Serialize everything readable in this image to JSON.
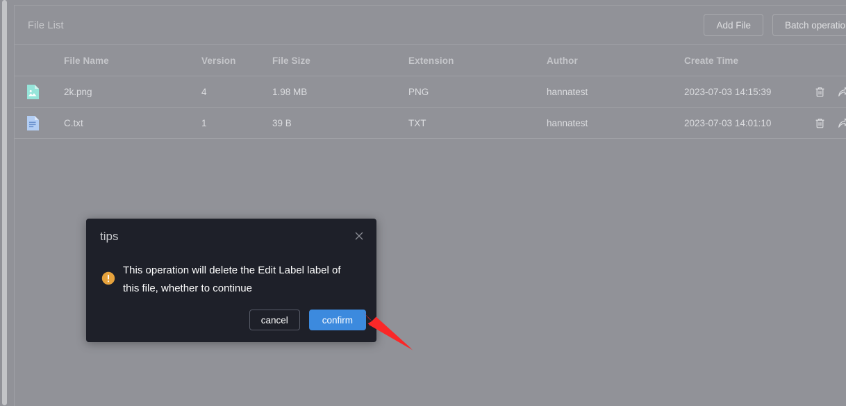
{
  "card": {
    "title": "File List",
    "actions": [
      {
        "label": "Add File",
        "name": "add-file-button"
      },
      {
        "label": "Batch operation",
        "name": "batch-operation-button"
      }
    ]
  },
  "table": {
    "columns": [
      {
        "key": "icon",
        "label": ""
      },
      {
        "key": "name",
        "label": "File Name"
      },
      {
        "key": "version",
        "label": "Version"
      },
      {
        "key": "size",
        "label": "File Size"
      },
      {
        "key": "extension",
        "label": "Extension"
      },
      {
        "key": "author",
        "label": "Author"
      },
      {
        "key": "time",
        "label": "Create Time"
      },
      {
        "key": "ops",
        "label": ""
      }
    ],
    "rows": [
      {
        "icon": "image-file-icon",
        "name": "2k.png",
        "version": "4",
        "size": "1.98 MB",
        "extension": "PNG",
        "author": "hannatest",
        "time": "2023-07-03 14:15:39",
        "ops": [
          "delete-icon",
          "share-icon"
        ]
      },
      {
        "icon": "text-file-icon",
        "name": "C.txt",
        "version": "1",
        "size": "39 B",
        "extension": "TXT",
        "author": "hannatest",
        "time": "2023-07-03 14:01:10",
        "ops": [
          "delete-icon",
          "share-icon"
        ]
      }
    ]
  },
  "dialog": {
    "title": "tips",
    "message": "This operation will delete the Edit Label label of this file, whether to continue",
    "close_label": "×",
    "cancel_label": "cancel",
    "confirm_label": "confirm"
  },
  "colors": {
    "page_background": "#919298",
    "dialog_background": "#1e2029",
    "confirm_button": "#3c8ade",
    "warning_icon": "#e6a23c",
    "annotation_arrow": "#fa2828",
    "image_file_icon": "#96e5da",
    "text_file_icon": "#b3cef4"
  }
}
